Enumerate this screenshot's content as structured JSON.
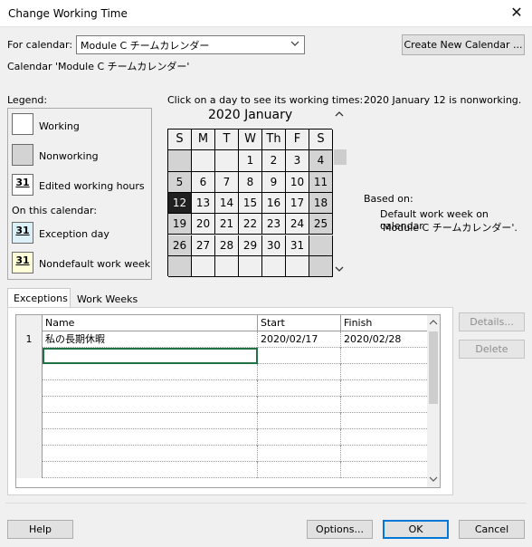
{
  "window": {
    "title": "Change Working Time"
  },
  "calendar_select": {
    "label": "For calendar:",
    "value": "Module C チームカレンダー"
  },
  "create_new_button": "Create New Calendar ...",
  "calendar_caption": "Calendar 'Module C チームカレンダー'",
  "legend": {
    "title": "Legend:",
    "working": "Working",
    "nonworking": "Nonworking",
    "edited": "Edited working hours",
    "on_this_calendar": "On this calendar:",
    "exception": "Exception day",
    "nondefault": "Nondefault work week",
    "swatch_digits": "31"
  },
  "calendar": {
    "instruction": "Click on a day to see its working times:",
    "month_title": "2020 January",
    "weekdays": [
      "S",
      "M",
      "T",
      "W",
      "Th",
      "F",
      "S"
    ],
    "weeks": [
      [
        "",
        "",
        "",
        "1",
        "2",
        "3",
        "4"
      ],
      [
        "5",
        "6",
        "7",
        "8",
        "9",
        "10",
        "11"
      ],
      [
        "12",
        "13",
        "14",
        "15",
        "16",
        "17",
        "18"
      ],
      [
        "19",
        "20",
        "21",
        "22",
        "23",
        "24",
        "25"
      ],
      [
        "26",
        "27",
        "28",
        "29",
        "30",
        "31",
        ""
      ],
      [
        "",
        "",
        "",
        "",
        "",
        "",
        ""
      ]
    ],
    "selected_day": "12"
  },
  "info": {
    "status": "2020 January 12 is nonworking.",
    "based_on_label": "Based on:",
    "based_on_line1": "Default work week on calendar",
    "based_on_line2": "'Module C チームカレンダー'."
  },
  "tabs": [
    "Exceptions",
    "Work Weeks"
  ],
  "exceptions_table": {
    "columns": [
      "Name",
      "Start",
      "Finish"
    ],
    "rows": [
      {
        "num": "1",
        "name": "私の長期休暇",
        "start": "2020/02/17",
        "finish": "2020/02/28"
      }
    ]
  },
  "side_buttons": {
    "details": "Details...",
    "delete": "Delete"
  },
  "footer": {
    "help": "Help",
    "options": "Options...",
    "ok": "OK",
    "cancel": "Cancel"
  },
  "colors": {
    "accent": "#0078d7",
    "active_cell": "#217346",
    "selected_day": "#202020",
    "nonworking": "#d3d3d3"
  }
}
